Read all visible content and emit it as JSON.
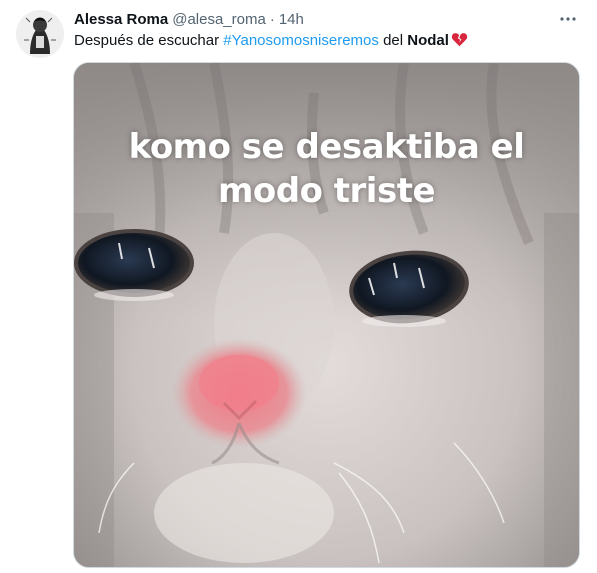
{
  "tweet": {
    "author": {
      "display_name": "Alessa Roma",
      "handle": "@alesa_roma",
      "separator": "·",
      "timestamp": "14h"
    },
    "text": {
      "prefix": "Después de escuchar ",
      "hashtag": "#Yanosomosniseremos",
      "middle": " del ",
      "bold": "Nodal",
      "emoji_icon": "broken-heart-icon"
    },
    "media": {
      "caption_line_1": "komo se desaktiba el",
      "caption_line_2": "modo triste"
    },
    "more_icon": "more-horizontal-icon"
  },
  "colors": {
    "text_primary": "#0f1419",
    "text_secondary": "#536471",
    "link": "#1d9bf0",
    "broken_heart": "#d7263d"
  }
}
